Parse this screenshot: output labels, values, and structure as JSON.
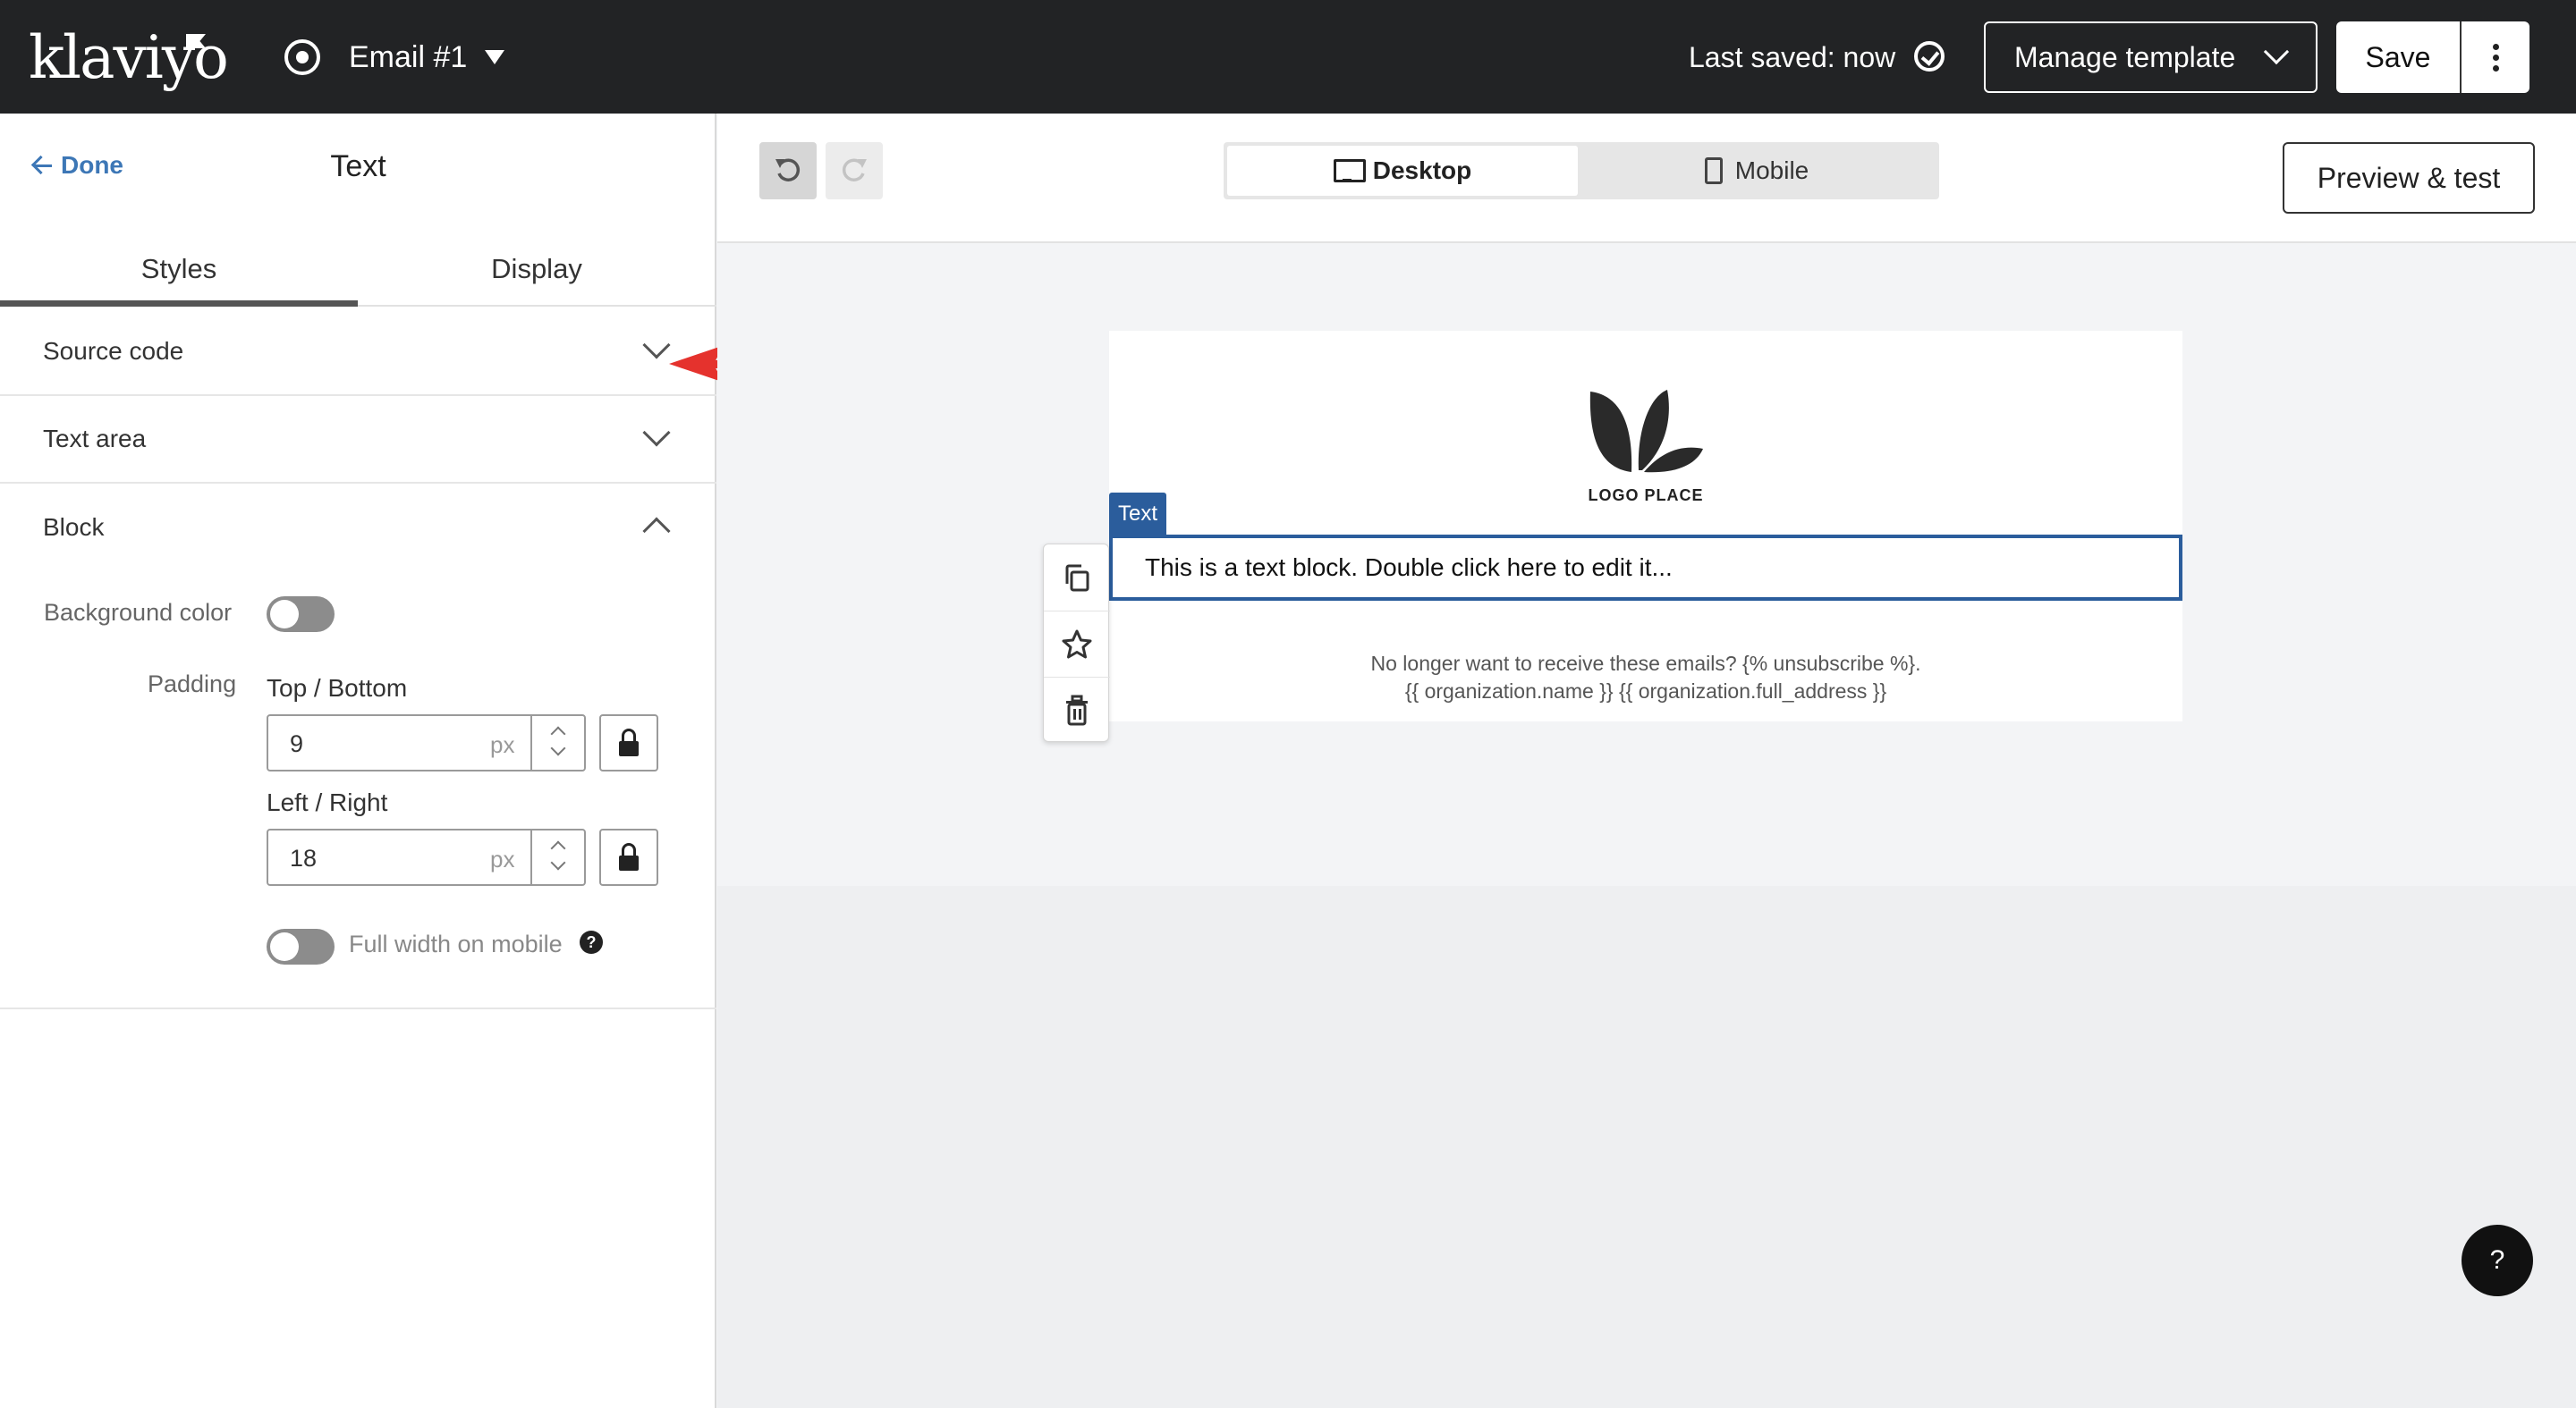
{
  "app": {
    "brand": "klaviyo",
    "email_name": "Email #1",
    "last_saved": "Last saved: now",
    "manage_template": "Manage template",
    "save": "Save"
  },
  "editor": {
    "done": "Done",
    "panel_title": "Text",
    "tabs": [
      "Styles",
      "Display"
    ],
    "sections": {
      "source_code": "Source code",
      "text_area": "Text area",
      "block": "Block"
    },
    "block": {
      "background_color_label": "Background color",
      "padding_label": "Padding",
      "top_bottom_label": "Top / Bottom",
      "top_bottom_value": "9",
      "left_right_label": "Left / Right",
      "left_right_value": "18",
      "unit": "px",
      "full_width_mobile_label": "Full width on mobile",
      "help_glyph": "?"
    }
  },
  "toolbar": {
    "device_desktop": "Desktop",
    "device_mobile": "Mobile",
    "preview_test": "Preview & test"
  },
  "canvas": {
    "logo_text": "LOGO PLACE",
    "selected_block_tag": "Text",
    "text_block_content": "This is a text block. Double click here to edit it...",
    "footer_line1": "No longer want to receive these emails? {% unsubscribe %}.",
    "footer_line2": "{{ organization.name }} {{ organization.full_address }}"
  },
  "help_fab": "?",
  "colors": {
    "topbar": "#222325",
    "accent_link": "#3d77b6",
    "selection": "#2b5d9c",
    "annotation_arrow": "#e5322d"
  }
}
